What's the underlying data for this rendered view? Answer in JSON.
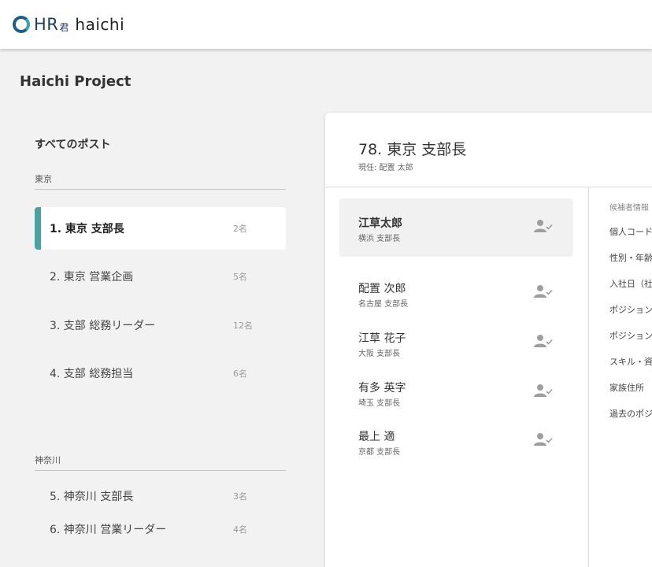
{
  "header": {
    "logo_hr": "HR",
    "logo_kun": "君",
    "logo_name": "haichi"
  },
  "project": {
    "title": "Haichi Project"
  },
  "posts": {
    "heading": "すべてのポスト",
    "groups": [
      {
        "label": "東京",
        "items": [
          {
            "name": "1. 東京 支部長",
            "count": "2名",
            "selected": true
          },
          {
            "name": "2. 東京 営業企画",
            "count": "5名"
          },
          {
            "name": "3. 支部 総務リーダー",
            "count": "12名"
          },
          {
            "name": "4. 支部 総務担当",
            "count": "6名"
          }
        ]
      },
      {
        "label": "神奈川",
        "items": [
          {
            "name": "5. 神奈川 支部長",
            "count": "3名"
          },
          {
            "name": "6. 神奈川 営業リーダー",
            "count": "4名"
          }
        ]
      }
    ]
  },
  "detail": {
    "title": "78. 東京 支部長",
    "current": "現任: 配置 太郎",
    "candidates": [
      {
        "name": "江草太郎",
        "sub": "横浜 支部長",
        "selected": true
      },
      {
        "name": "配置 次郎",
        "sub": "名古屋 支部長"
      },
      {
        "name": "江草 花子",
        "sub": "大阪 支部長"
      },
      {
        "name": "有多 英字",
        "sub": "埼玉 支部長"
      },
      {
        "name": "最上 適",
        "sub": "京都 支部長"
      }
    ],
    "info": {
      "heading": "候補者情報",
      "rows": [
        "個人コード",
        "性別・年齢",
        "入社日（社",
        "ポジション",
        "ポジション",
        "スキル・資",
        "家族住所",
        "過去のポジ"
      ]
    }
  },
  "colors": {
    "accent": "#4aa3a2",
    "logo_blue": "#1f5d8a",
    "background": "#f2f2f2"
  },
  "icons": {
    "candidate_icon": "user-check-icon"
  }
}
